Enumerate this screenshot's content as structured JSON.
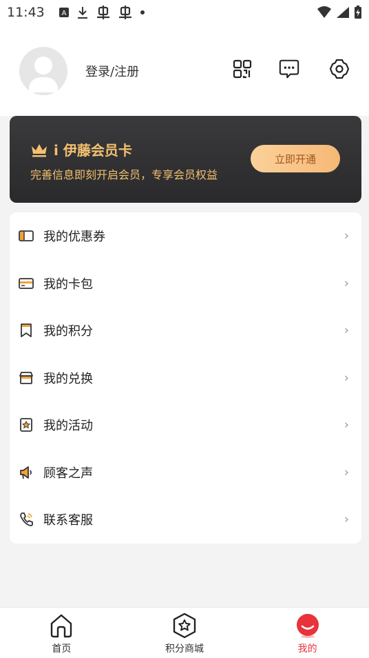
{
  "status_bar": {
    "time": "11:43",
    "icons": [
      "A-box-icon",
      "download-icon",
      "bug-icon",
      "bug-icon",
      "dot-icon"
    ],
    "right_icons": [
      "wifi-icon",
      "signal-icon",
      "battery-charging-icon"
    ]
  },
  "header": {
    "login_label": "登录/注册",
    "icons": [
      "qr-code-icon",
      "message-icon",
      "settings-icon"
    ]
  },
  "member_card": {
    "title": "i 伊藤会员卡",
    "subtitle": "完善信息即刻开启会员，专享会员权益",
    "button": "立即开通",
    "accent": "#f4c070"
  },
  "menu": {
    "items": [
      {
        "label": "我的优惠券",
        "icon": "coupon-icon"
      },
      {
        "label": "我的卡包",
        "icon": "card-wallet-icon"
      },
      {
        "label": "我的积分",
        "icon": "points-bookmark-icon"
      },
      {
        "label": "我的兑换",
        "icon": "exchange-store-icon"
      },
      {
        "label": "我的活动",
        "icon": "activity-badge-icon"
      },
      {
        "label": "顾客之声",
        "icon": "megaphone-icon"
      },
      {
        "label": "联系客服",
        "icon": "phone-icon"
      }
    ],
    "arrow": "›"
  },
  "tab_bar": {
    "tabs": [
      {
        "label": "首页",
        "icon": "home-icon",
        "active": false
      },
      {
        "label": "积分商城",
        "icon": "star-hexagon-icon",
        "active": false
      },
      {
        "label": "我的",
        "icon": "smile-face-icon",
        "active": true
      }
    ],
    "active_color": "#e8333a"
  }
}
